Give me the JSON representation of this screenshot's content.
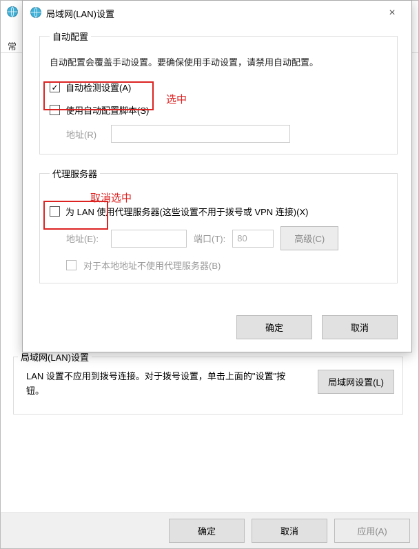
{
  "parent": {
    "tab_fragment": "常",
    "lan_section_title": "局域网(LAN)设置",
    "lan_section_desc": "LAN 设置不应用到拨号连接。对于拨号设置，单击上面的\"设置\"按钮。",
    "lan_settings_btn": "局域网设置(L)",
    "ok": "确定",
    "cancel": "取消",
    "apply": "应用(A)"
  },
  "dialog": {
    "title": "局域网(LAN)设置",
    "close": "×",
    "auto": {
      "legend": "自动配置",
      "desc": "自动配置会覆盖手动设置。要确保使用手动设置，请禁用自动配置。",
      "detect_label": "自动检测设置(A)",
      "script_label": "使用自动配置脚本(S)",
      "address_label": "地址(R)",
      "address_value": ""
    },
    "proxy": {
      "legend": "代理服务器",
      "use_label": "为 LAN 使用代理服务器(这些设置不用于拨号或 VPN 连接)(X)",
      "address_label": "地址(E):",
      "address_value": "",
      "port_label": "端口(T):",
      "port_value": "80",
      "advanced": "高级(C)",
      "bypass_label": "对于本地地址不使用代理服务器(B)"
    },
    "ok": "确定",
    "cancel": "取消"
  },
  "annotations": {
    "selected": "选中",
    "deselected": "取消选中"
  }
}
